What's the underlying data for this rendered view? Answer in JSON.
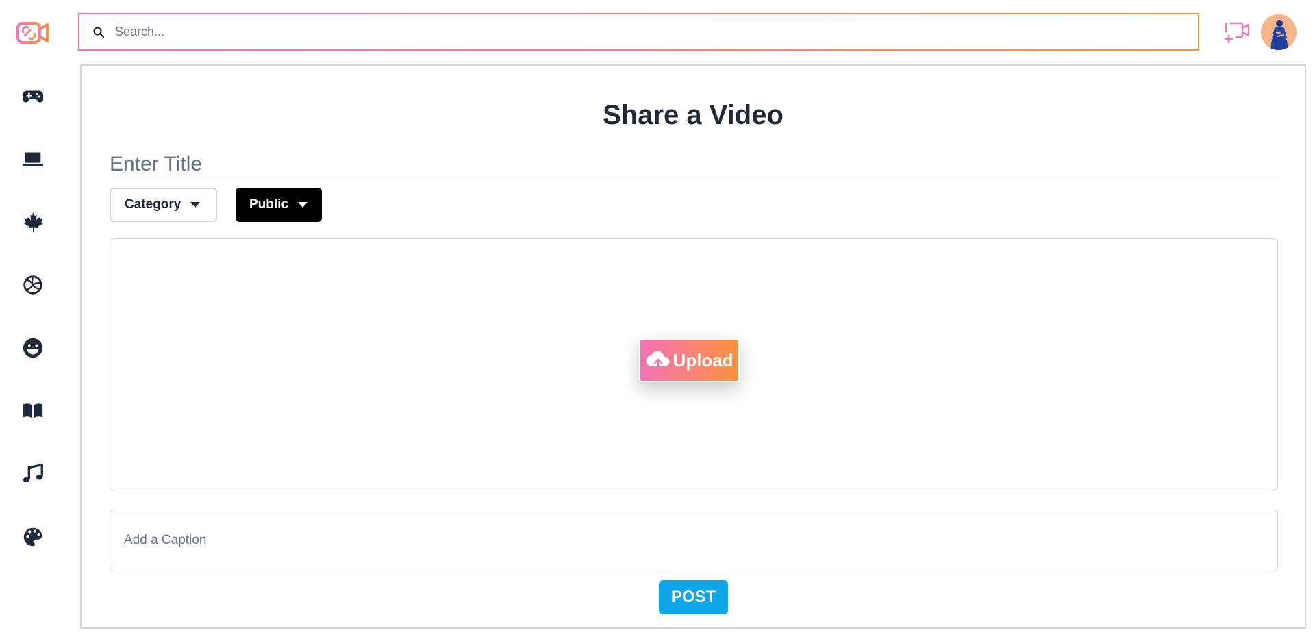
{
  "app": {
    "logo_icon": "video-link-logo-icon",
    "accent_gradient": [
      "#f472b6",
      "#fb923c"
    ]
  },
  "sidebar": {
    "items": [
      {
        "icon": "gamepad-icon",
        "name": "gaming"
      },
      {
        "icon": "laptop-icon",
        "name": "technology"
      },
      {
        "icon": "maple-leaf-icon",
        "name": "nature"
      },
      {
        "icon": "volleyball-icon",
        "name": "sports"
      },
      {
        "icon": "smile-icon",
        "name": "comedy"
      },
      {
        "icon": "book-icon",
        "name": "education"
      },
      {
        "icon": "music-icon",
        "name": "music"
      },
      {
        "icon": "palette-icon",
        "name": "art"
      }
    ],
    "icon_color": "#1e293b"
  },
  "header": {
    "search_placeholder": "Search...",
    "search_icon": "search-icon",
    "add_video_icon": "add-video-icon",
    "avatar_icon": "avatar"
  },
  "form": {
    "heading": "Share a Video",
    "title_placeholder": "Enter Title",
    "category_label": "Category",
    "visibility_label": "Public",
    "upload_label": "Upload",
    "upload_icon": "cloud-upload-icon",
    "caption_placeholder": "Add a Caption",
    "post_label": "POST",
    "post_color": "#0ea5e9"
  }
}
